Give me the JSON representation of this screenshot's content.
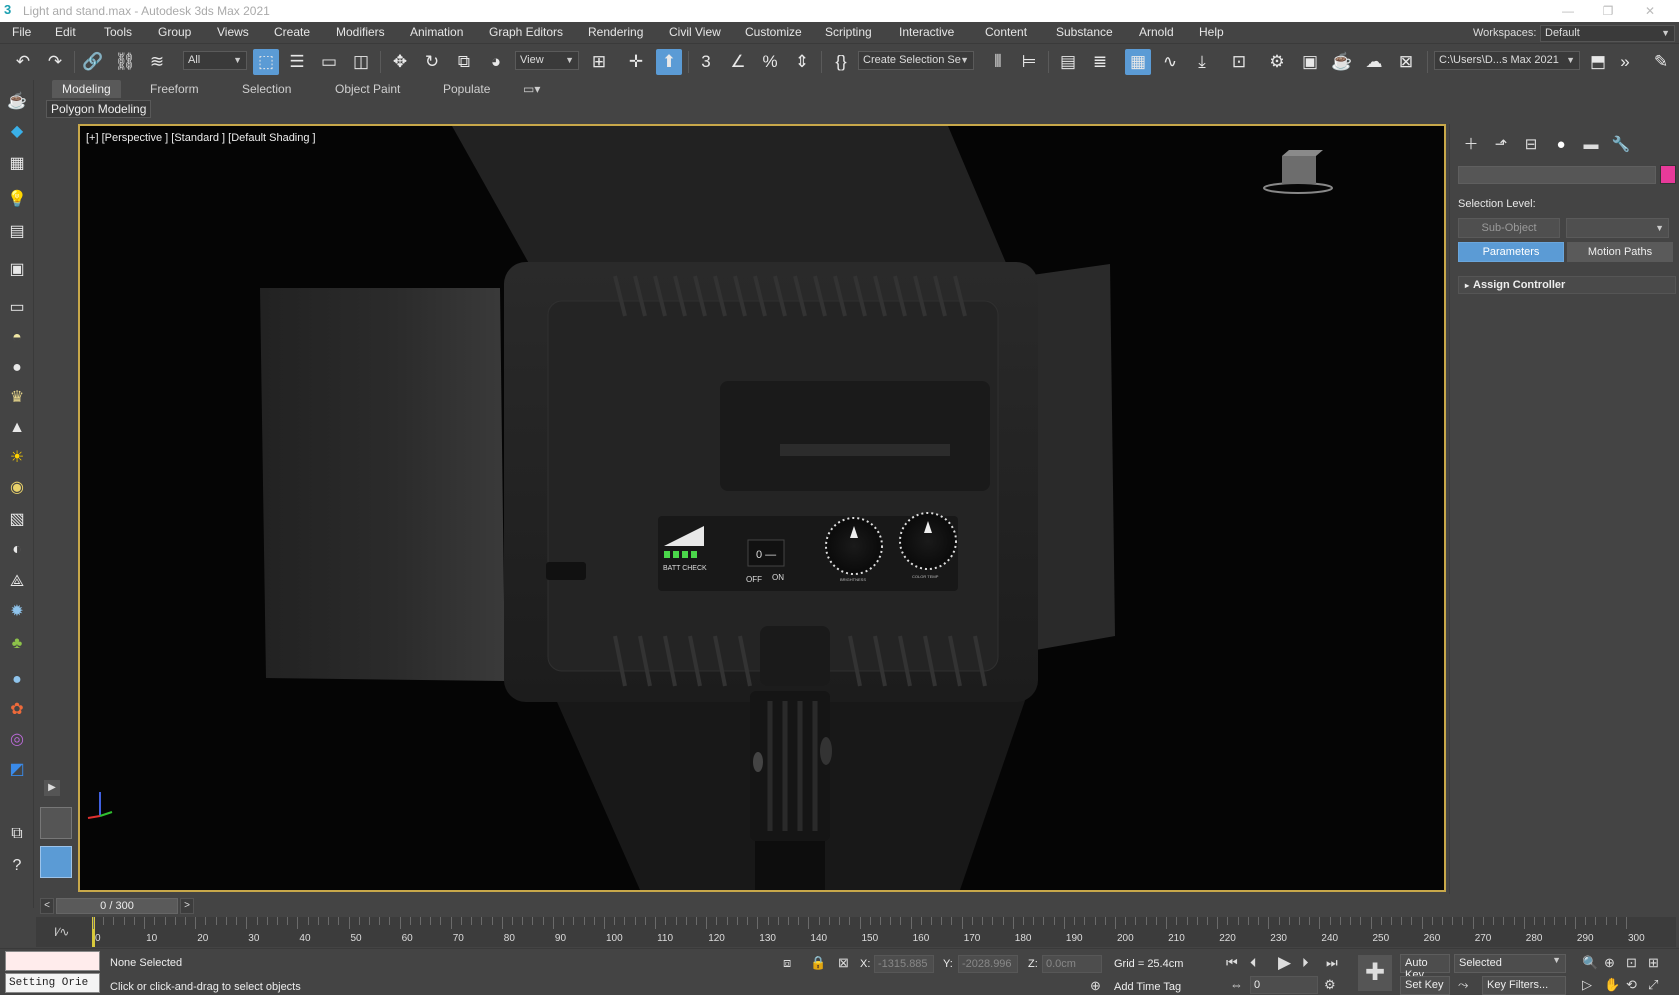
{
  "window": {
    "title": "Light and stand.max - Autodesk 3ds Max 2021",
    "icon": "3",
    "controls": [
      "—",
      "❐",
      "✕"
    ]
  },
  "menu": {
    "items": [
      "File",
      "Edit",
      "Tools",
      "Group",
      "Views",
      "Create",
      "Modifiers",
      "Animation",
      "Graph Editors",
      "Rendering",
      "Civil View",
      "Customize",
      "Scripting",
      "Interactive",
      "Content",
      "Substance",
      "Arnold",
      "Help"
    ],
    "workspaces_label": "Workspaces:",
    "workspace_value": "Default"
  },
  "toolbar": {
    "filter_value": "All",
    "ref_coord_value": "View",
    "selection_set_placeholder": "Create Selection Se",
    "project_path": "C:\\Users\\D...s Max 2021"
  },
  "ribbon": {
    "tabs": [
      "Modeling",
      "Freeform",
      "Selection",
      "Object Paint",
      "Populate"
    ],
    "sub_label": "Polygon Modeling"
  },
  "viewport": {
    "label": "[+] [Perspective ] [Standard ] [Default Shading ]",
    "panel_labels": {
      "batt_check": "BATT CHECK",
      "off": "OFF",
      "on": "ON",
      "switch": "0 —",
      "dial1": "BRIGHTNESS",
      "dial2": "COLOR TEMP"
    }
  },
  "command_panel": {
    "selection_level_label": "Selection Level:",
    "sub_object_btn": "Sub-Object",
    "parameters_btn": "Parameters",
    "motion_paths_btn": "Motion Paths",
    "rollout": "Assign Controller",
    "swatch_color": "#e83a9a"
  },
  "time_slider": {
    "frame_text": "0 / 300",
    "prev": "<",
    "next": ">"
  },
  "trackbar": {
    "labels": [
      "0",
      "10",
      "20",
      "30",
      "40",
      "50",
      "60",
      "70",
      "80",
      "90",
      "100",
      "110",
      "120",
      "130",
      "140",
      "150",
      "160",
      "170",
      "180",
      "190",
      "200",
      "210",
      "220",
      "230",
      "240",
      "250",
      "260",
      "270",
      "280",
      "290",
      "300"
    ]
  },
  "status": {
    "maxscript_line": "Setting Orie",
    "selection_text": "None Selected",
    "prompt_text": "Click or click-and-drag to select objects",
    "x_label": "X:",
    "x_value": "-1315.885",
    "y_label": "Y:",
    "y_value": "-2028.996",
    "z_label": "Z:",
    "z_value": "0.0cm",
    "grid_text": "Grid = 25.4cm",
    "add_time_tag": "Add Time Tag",
    "auto_key": "Auto Key",
    "set_key": "Set Key",
    "selected_value": "Selected",
    "key_filters": "Key Filters...",
    "frame_value": "0"
  }
}
